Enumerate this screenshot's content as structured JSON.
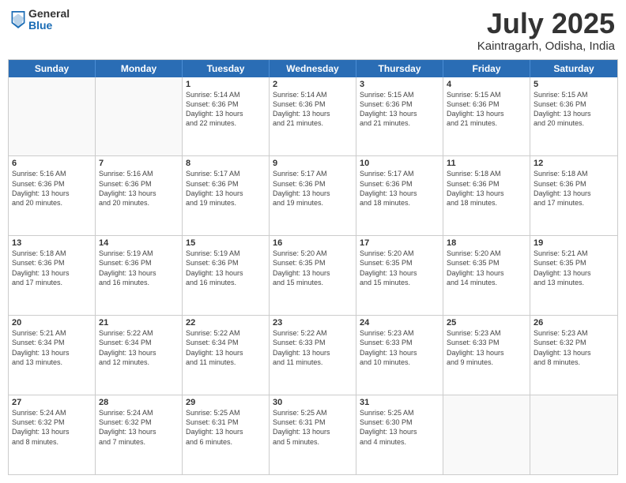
{
  "header": {
    "logo_general": "General",
    "logo_blue": "Blue",
    "month_title": "July 2025",
    "location": "Kaintragarh, Odisha, India"
  },
  "weekdays": [
    "Sunday",
    "Monday",
    "Tuesday",
    "Wednesday",
    "Thursday",
    "Friday",
    "Saturday"
  ],
  "rows": [
    [
      {
        "day": "",
        "lines": []
      },
      {
        "day": "",
        "lines": []
      },
      {
        "day": "1",
        "lines": [
          "Sunrise: 5:14 AM",
          "Sunset: 6:36 PM",
          "Daylight: 13 hours",
          "and 22 minutes."
        ]
      },
      {
        "day": "2",
        "lines": [
          "Sunrise: 5:14 AM",
          "Sunset: 6:36 PM",
          "Daylight: 13 hours",
          "and 21 minutes."
        ]
      },
      {
        "day": "3",
        "lines": [
          "Sunrise: 5:15 AM",
          "Sunset: 6:36 PM",
          "Daylight: 13 hours",
          "and 21 minutes."
        ]
      },
      {
        "day": "4",
        "lines": [
          "Sunrise: 5:15 AM",
          "Sunset: 6:36 PM",
          "Daylight: 13 hours",
          "and 21 minutes."
        ]
      },
      {
        "day": "5",
        "lines": [
          "Sunrise: 5:15 AM",
          "Sunset: 6:36 PM",
          "Daylight: 13 hours",
          "and 20 minutes."
        ]
      }
    ],
    [
      {
        "day": "6",
        "lines": [
          "Sunrise: 5:16 AM",
          "Sunset: 6:36 PM",
          "Daylight: 13 hours",
          "and 20 minutes."
        ]
      },
      {
        "day": "7",
        "lines": [
          "Sunrise: 5:16 AM",
          "Sunset: 6:36 PM",
          "Daylight: 13 hours",
          "and 20 minutes."
        ]
      },
      {
        "day": "8",
        "lines": [
          "Sunrise: 5:17 AM",
          "Sunset: 6:36 PM",
          "Daylight: 13 hours",
          "and 19 minutes."
        ]
      },
      {
        "day": "9",
        "lines": [
          "Sunrise: 5:17 AM",
          "Sunset: 6:36 PM",
          "Daylight: 13 hours",
          "and 19 minutes."
        ]
      },
      {
        "day": "10",
        "lines": [
          "Sunrise: 5:17 AM",
          "Sunset: 6:36 PM",
          "Daylight: 13 hours",
          "and 18 minutes."
        ]
      },
      {
        "day": "11",
        "lines": [
          "Sunrise: 5:18 AM",
          "Sunset: 6:36 PM",
          "Daylight: 13 hours",
          "and 18 minutes."
        ]
      },
      {
        "day": "12",
        "lines": [
          "Sunrise: 5:18 AM",
          "Sunset: 6:36 PM",
          "Daylight: 13 hours",
          "and 17 minutes."
        ]
      }
    ],
    [
      {
        "day": "13",
        "lines": [
          "Sunrise: 5:18 AM",
          "Sunset: 6:36 PM",
          "Daylight: 13 hours",
          "and 17 minutes."
        ]
      },
      {
        "day": "14",
        "lines": [
          "Sunrise: 5:19 AM",
          "Sunset: 6:36 PM",
          "Daylight: 13 hours",
          "and 16 minutes."
        ]
      },
      {
        "day": "15",
        "lines": [
          "Sunrise: 5:19 AM",
          "Sunset: 6:36 PM",
          "Daylight: 13 hours",
          "and 16 minutes."
        ]
      },
      {
        "day": "16",
        "lines": [
          "Sunrise: 5:20 AM",
          "Sunset: 6:35 PM",
          "Daylight: 13 hours",
          "and 15 minutes."
        ]
      },
      {
        "day": "17",
        "lines": [
          "Sunrise: 5:20 AM",
          "Sunset: 6:35 PM",
          "Daylight: 13 hours",
          "and 15 minutes."
        ]
      },
      {
        "day": "18",
        "lines": [
          "Sunrise: 5:20 AM",
          "Sunset: 6:35 PM",
          "Daylight: 13 hours",
          "and 14 minutes."
        ]
      },
      {
        "day": "19",
        "lines": [
          "Sunrise: 5:21 AM",
          "Sunset: 6:35 PM",
          "Daylight: 13 hours",
          "and 13 minutes."
        ]
      }
    ],
    [
      {
        "day": "20",
        "lines": [
          "Sunrise: 5:21 AM",
          "Sunset: 6:34 PM",
          "Daylight: 13 hours",
          "and 13 minutes."
        ]
      },
      {
        "day": "21",
        "lines": [
          "Sunrise: 5:22 AM",
          "Sunset: 6:34 PM",
          "Daylight: 13 hours",
          "and 12 minutes."
        ]
      },
      {
        "day": "22",
        "lines": [
          "Sunrise: 5:22 AM",
          "Sunset: 6:34 PM",
          "Daylight: 13 hours",
          "and 11 minutes."
        ]
      },
      {
        "day": "23",
        "lines": [
          "Sunrise: 5:22 AM",
          "Sunset: 6:33 PM",
          "Daylight: 13 hours",
          "and 11 minutes."
        ]
      },
      {
        "day": "24",
        "lines": [
          "Sunrise: 5:23 AM",
          "Sunset: 6:33 PM",
          "Daylight: 13 hours",
          "and 10 minutes."
        ]
      },
      {
        "day": "25",
        "lines": [
          "Sunrise: 5:23 AM",
          "Sunset: 6:33 PM",
          "Daylight: 13 hours",
          "and 9 minutes."
        ]
      },
      {
        "day": "26",
        "lines": [
          "Sunrise: 5:23 AM",
          "Sunset: 6:32 PM",
          "Daylight: 13 hours",
          "and 8 minutes."
        ]
      }
    ],
    [
      {
        "day": "27",
        "lines": [
          "Sunrise: 5:24 AM",
          "Sunset: 6:32 PM",
          "Daylight: 13 hours",
          "and 8 minutes."
        ]
      },
      {
        "day": "28",
        "lines": [
          "Sunrise: 5:24 AM",
          "Sunset: 6:32 PM",
          "Daylight: 13 hours",
          "and 7 minutes."
        ]
      },
      {
        "day": "29",
        "lines": [
          "Sunrise: 5:25 AM",
          "Sunset: 6:31 PM",
          "Daylight: 13 hours",
          "and 6 minutes."
        ]
      },
      {
        "day": "30",
        "lines": [
          "Sunrise: 5:25 AM",
          "Sunset: 6:31 PM",
          "Daylight: 13 hours",
          "and 5 minutes."
        ]
      },
      {
        "day": "31",
        "lines": [
          "Sunrise: 5:25 AM",
          "Sunset: 6:30 PM",
          "Daylight: 13 hours",
          "and 4 minutes."
        ]
      },
      {
        "day": "",
        "lines": []
      },
      {
        "day": "",
        "lines": []
      }
    ]
  ]
}
